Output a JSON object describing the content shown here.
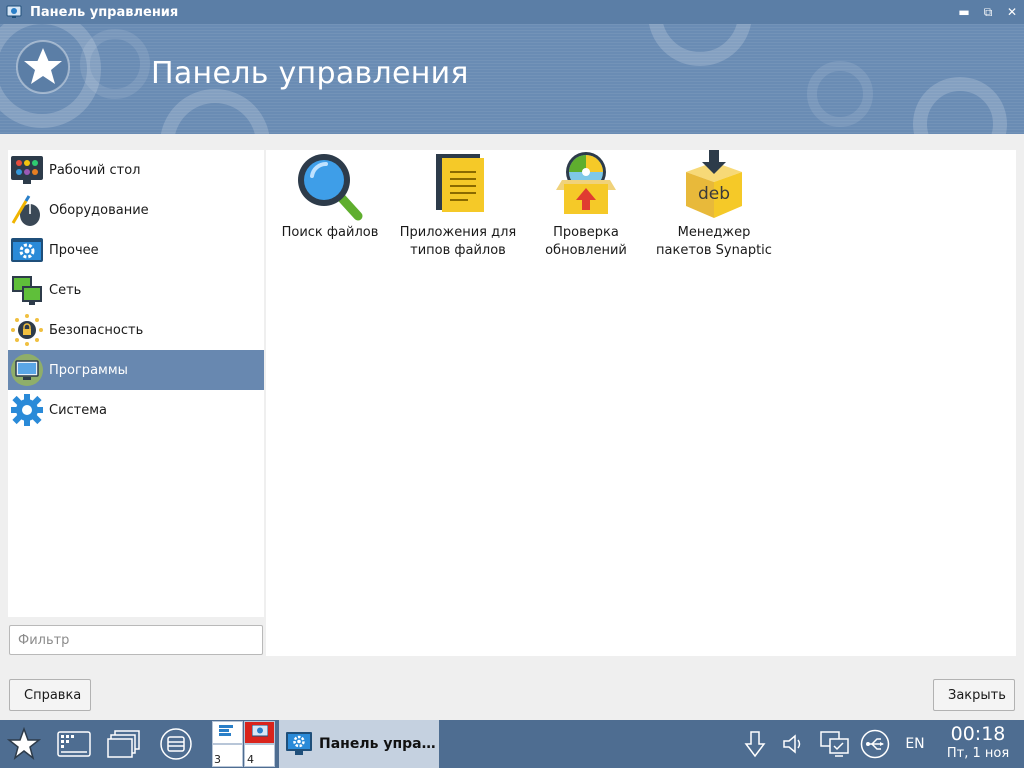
{
  "window": {
    "title": "Панель управления",
    "minimize_icon": "minimize-icon",
    "maximize_icon": "restore-icon",
    "close_icon": "close-icon"
  },
  "banner": {
    "heading": "Панель управления"
  },
  "sidebar": {
    "items": [
      {
        "label": "Рабочий стол",
        "icon": "desktop-icon"
      },
      {
        "label": "Оборудование",
        "icon": "hardware-icon"
      },
      {
        "label": "Прочее",
        "icon": "other-icon"
      },
      {
        "label": "Сеть",
        "icon": "network-icon"
      },
      {
        "label": "Безопасность",
        "icon": "security-icon"
      },
      {
        "label": "Программы",
        "icon": "programs-icon",
        "selected": true
      },
      {
        "label": "Система",
        "icon": "system-gear-icon"
      }
    ]
  },
  "filter": {
    "placeholder": "Фильтр",
    "value": ""
  },
  "apps": [
    {
      "label": "Поиск файлов",
      "icon": "file-search-icon"
    },
    {
      "label": "Приложения для типов файлов",
      "icon": "file-types-icon"
    },
    {
      "label": "Проверка обновлений",
      "icon": "update-check-icon"
    },
    {
      "label": "Менеджер пакетов Synaptic",
      "icon": "synaptic-package-icon"
    }
  ],
  "buttons": {
    "help": "Справка",
    "close": "Закрыть"
  },
  "taskbar": {
    "workspaces": [
      "",
      "",
      "3",
      "4"
    ],
    "task_label": "Панель упра…",
    "lang": "EN",
    "time": "00:18",
    "date": "Пт, 1 ноя"
  },
  "colors": {
    "titlebar": "#5b7ea6",
    "banner": "#6a8cb4",
    "selected": "#6888b0",
    "taskbar": "#4e6d91"
  }
}
